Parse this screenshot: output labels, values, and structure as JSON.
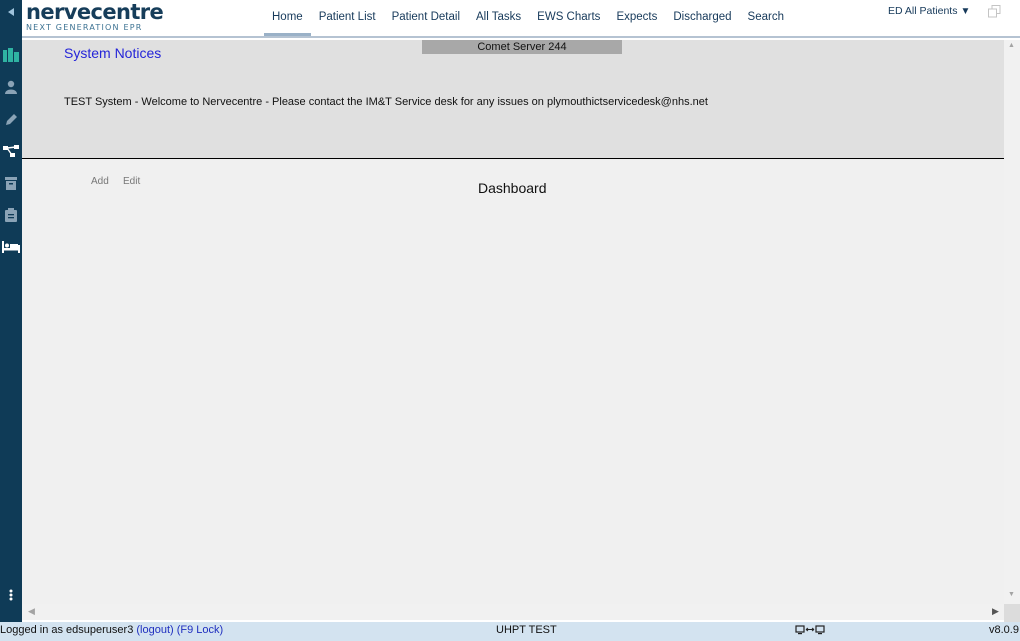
{
  "logo": {
    "brand": "nervecentre",
    "tagline": "NEXT GENERATION EPR"
  },
  "nav": {
    "tabs": [
      {
        "label": "Home"
      },
      {
        "label": "Patient List"
      },
      {
        "label": "Patient Detail"
      },
      {
        "label": "All Tasks"
      },
      {
        "label": "EWS Charts"
      },
      {
        "label": "Expects"
      },
      {
        "label": "Discharged"
      },
      {
        "label": "Search"
      }
    ],
    "active_tab": "Home"
  },
  "ward_selector": {
    "value": "ED All Patients",
    "caret": "▼"
  },
  "sidebar": {
    "icons": [
      "collapse-arrow-icon",
      "ward-overview-icon",
      "patient-icon",
      "clinical-note-icon",
      "pathway-icon",
      "archive-icon",
      "clipboard-icon",
      "bed-icon",
      "more-options-icon"
    ]
  },
  "system_notices": {
    "title": "System Notices",
    "server": "Comet Server 244",
    "message": "TEST System - Welcome to Nervecentre - Please contact the IM&T Service desk for any issues on plymouthictservicedesk@nhs.net"
  },
  "dashboard": {
    "add_label": "Add",
    "edit_label": "Edit",
    "title": "Dashboard"
  },
  "status_bar": {
    "logged_in_prefix": "Logged in as edsuperuser3",
    "logout_label": "(logout)",
    "lock_label": "(F9 Lock)",
    "environment": "UHPT TEST",
    "version": "v8.0.9"
  },
  "colors": {
    "sidebar_bg": "#0f3b57",
    "brand": "#163d5a",
    "notice_title": "#2525d8",
    "status_bg": "#d3e3f0"
  }
}
